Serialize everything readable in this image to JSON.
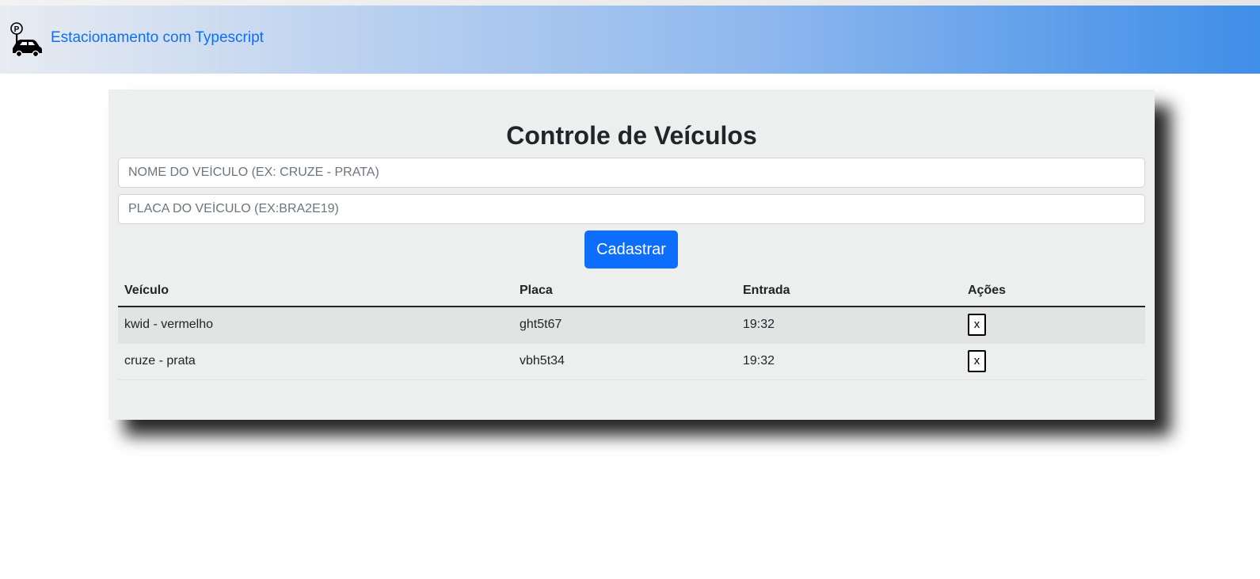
{
  "navbar": {
    "brand": "Estacionamento com Typescript",
    "icon": "parking-car-icon"
  },
  "form": {
    "title": "Controle de Veículos",
    "nome_placeholder": "NOME DO VEÍCULO (EX: CRUZE - PRATA)",
    "nome_value": "",
    "placa_placeholder": "PLACA DO VEÍCULO (EX:BRA2E19)",
    "placa_value": "",
    "submit_label": "Cadastrar"
  },
  "table": {
    "headers": [
      "Veículo",
      "Placa",
      "Entrada",
      "Ações"
    ],
    "rows": [
      {
        "veiculo": "kwid - vermelho",
        "placa": "ght5t67",
        "entrada": "19:32",
        "acao": "x"
      },
      {
        "veiculo": "cruze - prata",
        "placa": "vbh5t34",
        "entrada": "19:32",
        "acao": "x"
      }
    ]
  },
  "colors": {
    "accent": "#0d6efd",
    "card_bg": "#edeeee",
    "stripe": "#e2e3e3"
  }
}
